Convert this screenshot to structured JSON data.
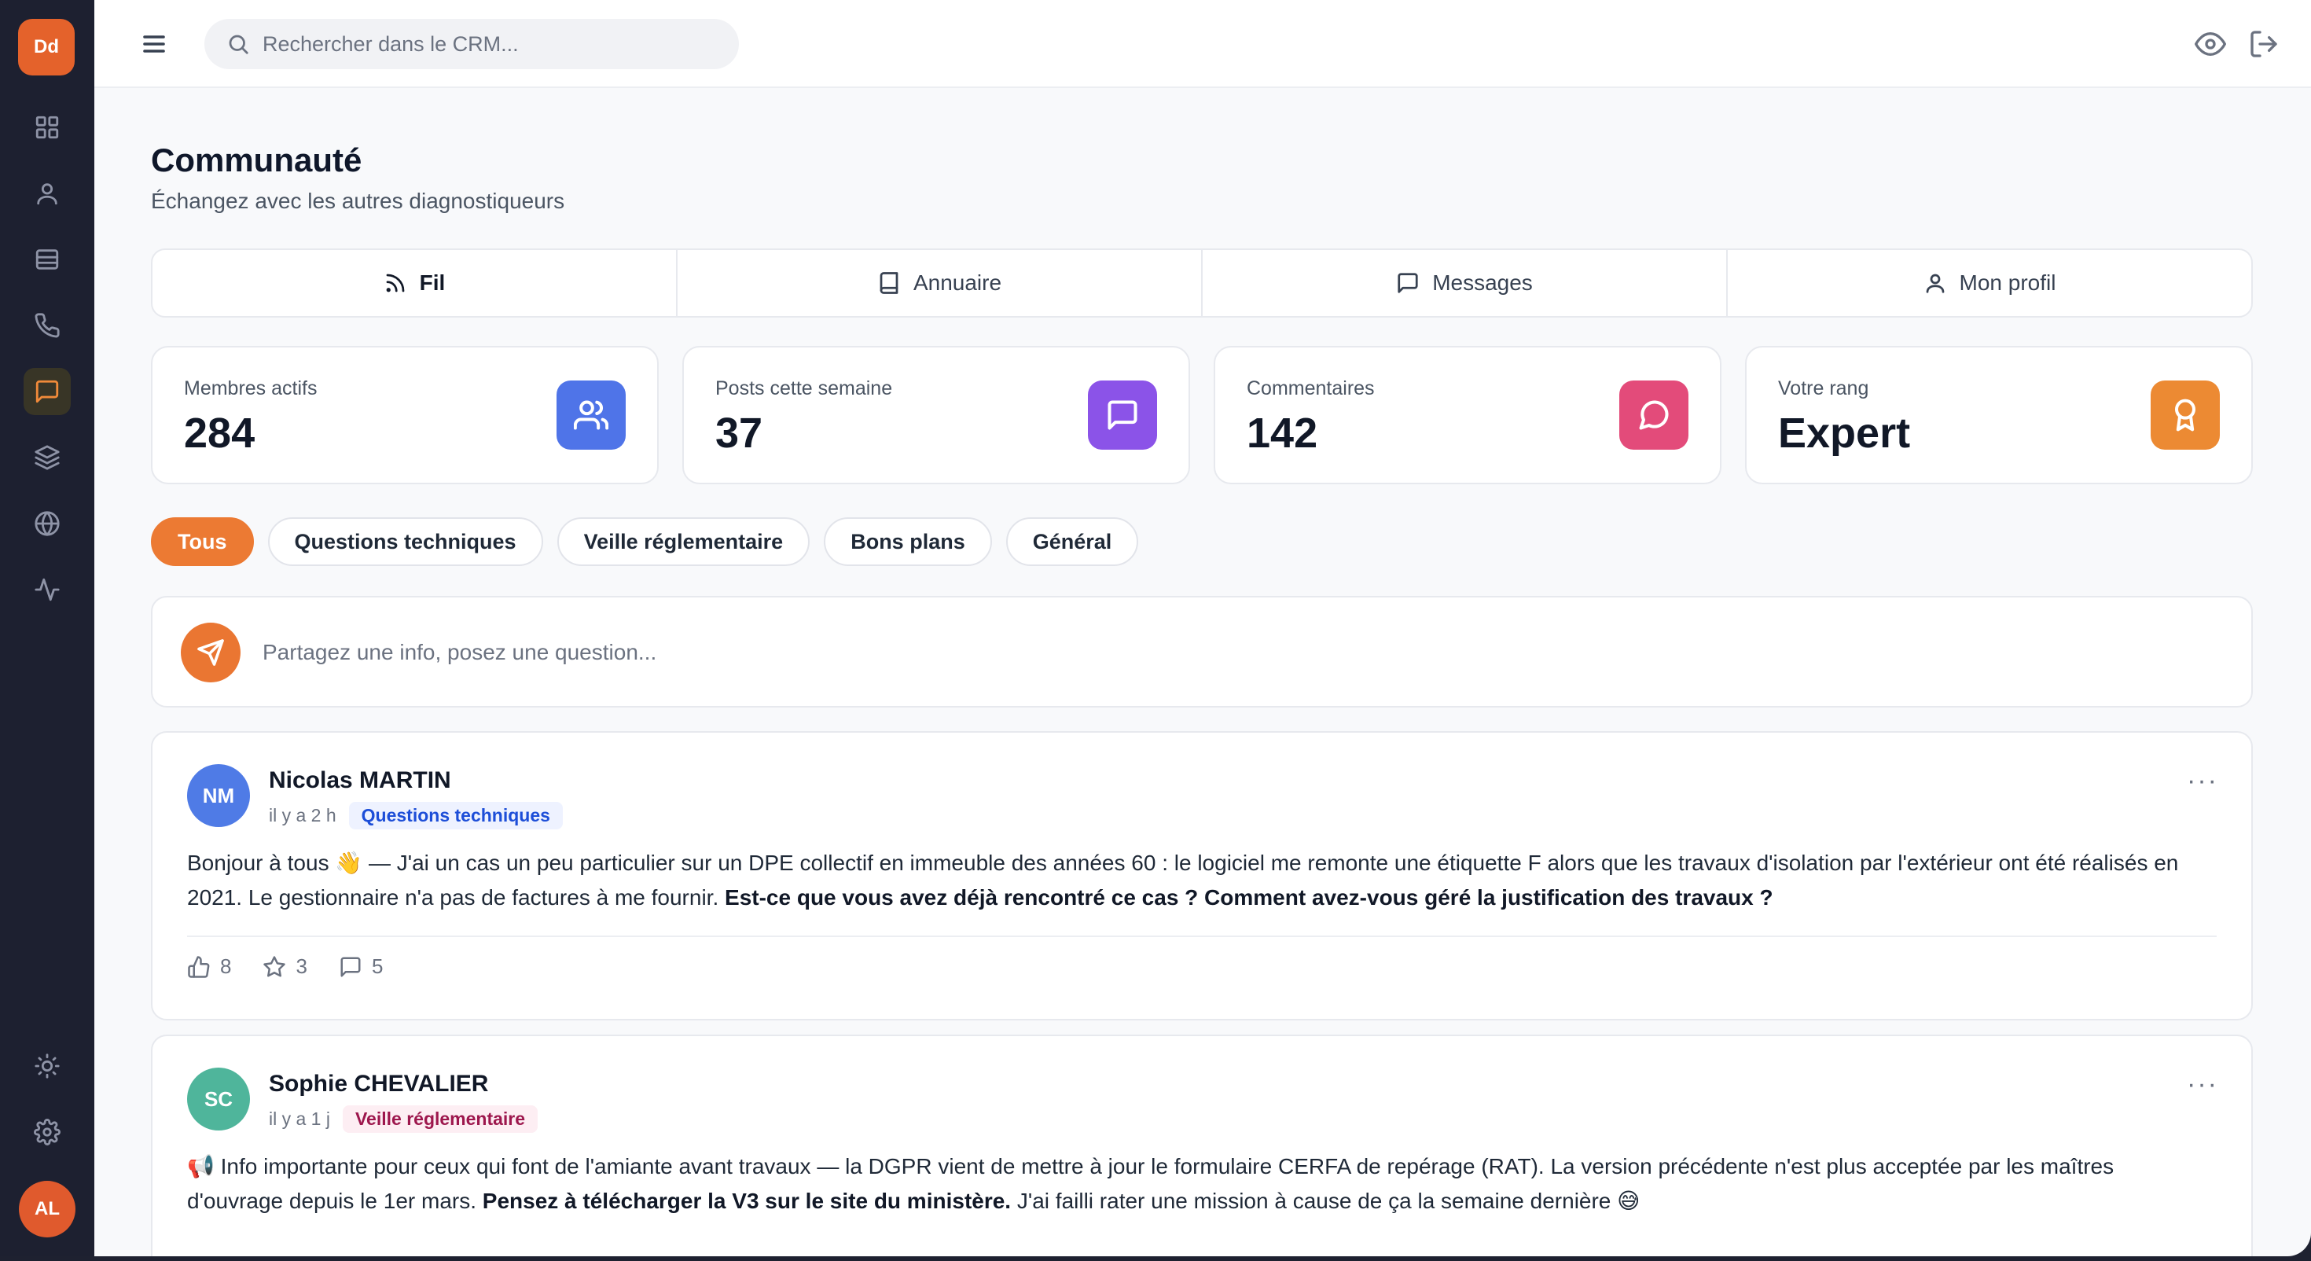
{
  "sidebar": {
    "logo": "Dd",
    "user_initials": "AL",
    "items": [
      {
        "icon": "grid-icon"
      },
      {
        "icon": "user-icon"
      },
      {
        "icon": "card-icon"
      },
      {
        "icon": "phone-icon"
      },
      {
        "icon": "message-icon",
        "active": true
      },
      {
        "icon": "layers-icon"
      },
      {
        "icon": "globe-icon"
      },
      {
        "icon": "activity-icon"
      }
    ],
    "bottom_items": [
      {
        "icon": "sun-icon"
      },
      {
        "icon": "gear-icon"
      }
    ]
  },
  "topbar": {
    "search_placeholder": "Rechercher dans le CRM..."
  },
  "page": {
    "title": "Communauté",
    "subtitle": "Échangez avec les autres diagnostiqueurs"
  },
  "tabs": [
    {
      "label": "Fil",
      "icon": "rss-icon",
      "active": true
    },
    {
      "label": "Annuaire",
      "icon": "book-icon"
    },
    {
      "label": "Messages",
      "icon": "message-icon"
    },
    {
      "label": "Mon profil",
      "icon": "user-icon"
    }
  ],
  "stats": [
    {
      "label": "Membres actifs",
      "value": "284",
      "icon": "users-icon",
      "color": "#4f74e8"
    },
    {
      "label": "Posts cette semaine",
      "value": "37",
      "icon": "message-square-icon",
      "color": "#8b53e8"
    },
    {
      "label": "Commentaires",
      "value": "142",
      "icon": "message-circle-icon",
      "color": "#e34b7a"
    },
    {
      "label": "Votre rang",
      "value": "Expert",
      "icon": "award-icon",
      "color": "#ec8a33"
    }
  ],
  "filters": [
    {
      "label": "Tous",
      "active": true
    },
    {
      "label": "Questions techniques"
    },
    {
      "label": "Veille réglementaire"
    },
    {
      "label": "Bons plans"
    },
    {
      "label": "Général"
    }
  ],
  "composer": {
    "placeholder": "Partagez une info, posez une question..."
  },
  "posts": [
    {
      "initials": "NM",
      "avatar_color": "#4f7be6",
      "author": "Nicolas MARTIN",
      "time": "il y a 2 h",
      "tag": "Questions techniques",
      "tag_color": "#1d4ed8",
      "tag_bg": "#eef2ff",
      "body_text": "Bonjour à tous 👋 — J'ai un cas un peu particulier sur un DPE collectif en immeuble des années 60 : le logiciel me remonte une étiquette F alors que les travaux d'isolation par l'extérieur ont été réalisés en 2021. Le gestionnaire n'a pas de factures à me fournir.",
      "body_bold": "Est-ce que vous avez déjà rencontré ce cas ? Comment avez-vous géré la justification des travaux ?",
      "likes": "8",
      "stars": "3",
      "comments": "5"
    },
    {
      "initials": "SC",
      "avatar_color": "#4fb59b",
      "author": "Sophie CHEVALIER",
      "time": "il y a 1 j",
      "tag": "Veille réglementaire",
      "tag_color": "#9d174d",
      "tag_bg": "#fdeef3",
      "body_text": "📢 Info importante pour ceux qui font de l'amiante avant travaux — la DGPR vient de mettre à jour le formulaire CERFA de repérage (RAT). La version précédente n'est plus acceptée par les maîtres d'ouvrage depuis le 1er mars.",
      "body_bold": "Pensez à télécharger la V3 sur le site du ministère.",
      "body_after": "J'ai failli rater une mission à cause de ça la semaine dernière 😅"
    }
  ],
  "more_label": "···"
}
